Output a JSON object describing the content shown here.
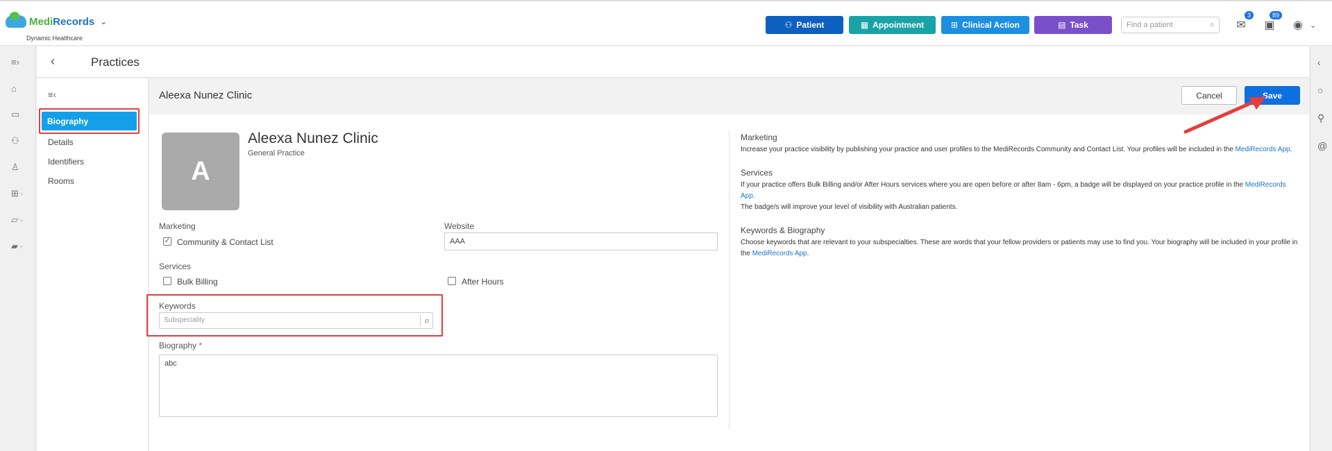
{
  "header": {
    "logo_medi": "Medi",
    "logo_records": "Records",
    "logo_sub": "Dynamic Healthcare",
    "buttons": {
      "patient": "Patient",
      "appointment": "Appointment",
      "clinical_action": "Clinical Action",
      "task": "Task"
    },
    "search_placeholder": "Find a patient",
    "mail_badge": "3",
    "tasks_badge": "89"
  },
  "page": {
    "title": "Practices"
  },
  "subnav": {
    "items": [
      "Biography",
      "Details",
      "Identifiers",
      "Rooms"
    ],
    "active": "Biography"
  },
  "panel": {
    "title": "Aleexa Nunez Clinic",
    "cancel_label": "Cancel",
    "save_label": "Save",
    "avatar_letter": "A",
    "clinic_name": "Aleexa Nunez Clinic",
    "clinic_type": "General Practice",
    "marketing_label": "Marketing",
    "community_label": "Community & Contact List",
    "community_checked": true,
    "website_label": "Website",
    "website_value": "AAA",
    "services_label": "Services",
    "bulk_billing_label": "Bulk Billing",
    "after_hours_label": "After Hours",
    "keywords_label": "Keywords",
    "keywords_placeholder": "Subspeciality",
    "biography_label": "Biography",
    "biography_required": "*",
    "biography_value": "abc"
  },
  "info": {
    "marketing_title": "Marketing",
    "marketing_text": "Increase your practice visibility by publishing your practice and user profiles to the MediRecords Community and Contact List. Your profiles will be included in the ",
    "marketing_link": "MediRecords App",
    "marketing_end": ".",
    "services_title": "Services",
    "services_text": "If your practice offers Bulk Billing and/or After Hours services where you are open before or after 8am - 6pm, a badge will be displayed on your practice profile in the ",
    "services_link": "MediRecords App",
    "services_end": ".",
    "services_text2": "The badge/s will improve your level of visibility with Australian patients.",
    "keywords_title": "Keywords & Biography",
    "keywords_text": "Choose keywords that are relevant to your subspecialties. These are words that your fellow providers or patients may use to find you. Your biography will be included in your profile in the ",
    "keywords_link": "MediRecords App",
    "keywords_end": "."
  },
  "colors": {
    "accent_blue": "#0d6fe0",
    "nav_active": "#14a0e8",
    "highlight_red": "#e53d3d"
  }
}
